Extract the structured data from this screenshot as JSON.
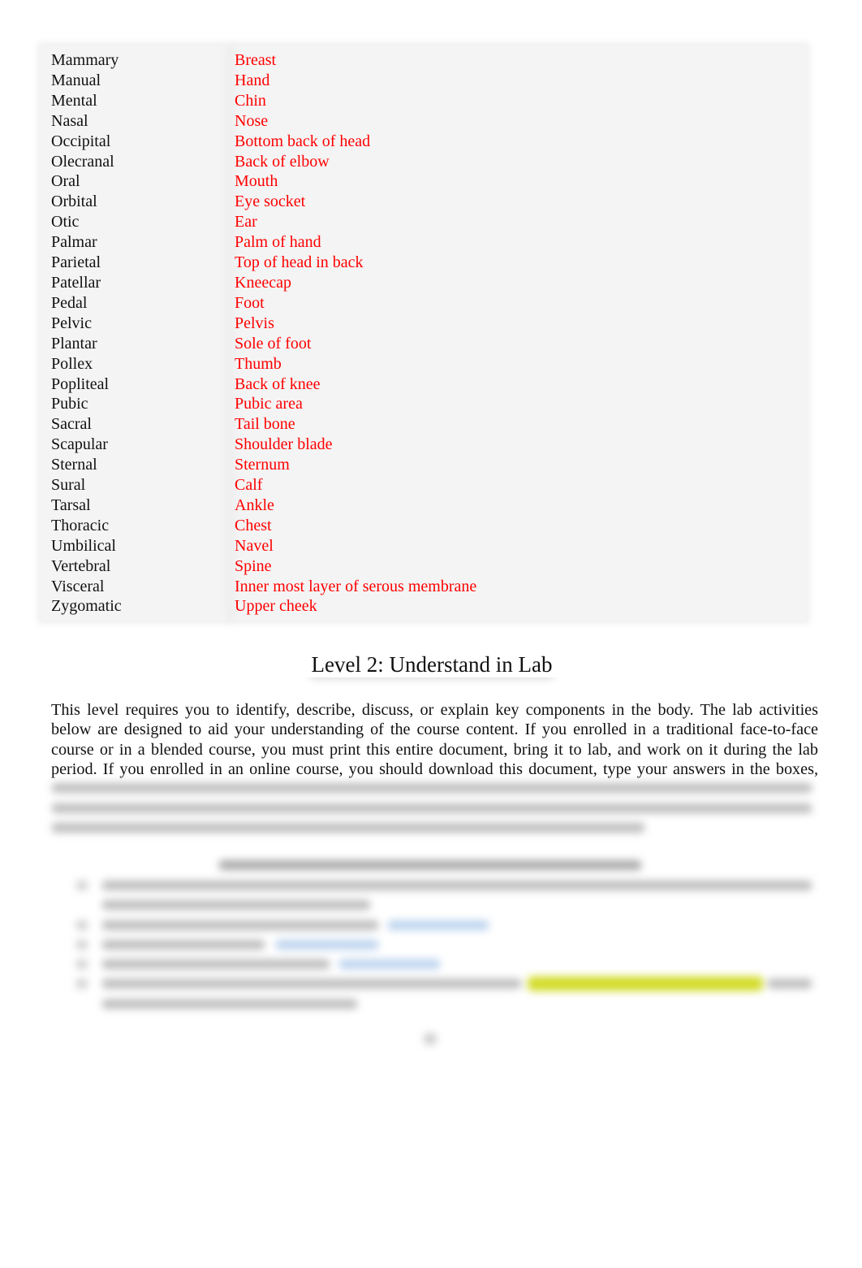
{
  "table": {
    "rows": [
      {
        "term": "Mammary",
        "meaning": "Breast"
      },
      {
        "term": "Manual",
        "meaning": "Hand"
      },
      {
        "term": "Mental",
        "meaning": "Chin"
      },
      {
        "term": "Nasal",
        "meaning": "Nose"
      },
      {
        "term": "Occipital",
        "meaning": "Bottom back of head"
      },
      {
        "term": "Olecranal",
        "meaning": "Back of elbow"
      },
      {
        "term": "Oral",
        "meaning": "Mouth"
      },
      {
        "term": "Orbital",
        "meaning": "Eye socket"
      },
      {
        "term": "Otic",
        "meaning": "Ear"
      },
      {
        "term": "Palmar",
        "meaning": "Palm of hand"
      },
      {
        "term": "Parietal",
        "meaning": "Top of head in back"
      },
      {
        "term": "Patellar",
        "meaning": "Kneecap"
      },
      {
        "term": "Pedal",
        "meaning": "Foot"
      },
      {
        "term": "Pelvic",
        "meaning": "Pelvis"
      },
      {
        "term": "Plantar",
        "meaning": "Sole of foot"
      },
      {
        "term": "Pollex",
        "meaning": "Thumb"
      },
      {
        "term": "Popliteal",
        "meaning": "Back of knee"
      },
      {
        "term": "Pubic",
        "meaning": "Pubic area"
      },
      {
        "term": "Sacral",
        "meaning": "Tail bone"
      },
      {
        "term": "Scapular",
        "meaning": "Shoulder blade"
      },
      {
        "term": "Sternal",
        "meaning": "Sternum"
      },
      {
        "term": "Sural",
        "meaning": "Calf"
      },
      {
        "term": "Tarsal",
        "meaning": "Ankle"
      },
      {
        "term": "Thoracic",
        "meaning": "Chest"
      },
      {
        "term": "Umbilical",
        "meaning": "Navel"
      },
      {
        "term": "Vertebral",
        "meaning": "Spine"
      },
      {
        "term": "Visceral",
        "meaning": "Inner most layer of serous membrane"
      },
      {
        "term": "Zygomatic",
        "meaning": "Upper cheek"
      }
    ]
  },
  "section": {
    "heading": "Level 2: Understand in Lab",
    "paragraph_lines": [
      "This level requires you to identify, describe, discuss, or explain key components in the body. The lab activities",
      "below are designed to aid your understanding of the course content. If you enrolled in a traditional face-to-face",
      "course or in a blended course, you must print this entire document, bring it to lab, and work on it during the lab",
      "period. If you enrolled in an online course, you should download this document, type your answers in the boxes,"
    ]
  },
  "colors": {
    "meaning_text": "#ff0000",
    "body_text": "#111111",
    "link_blur": "#bcd3ee",
    "highlight_blur": "#d3dc2a"
  }
}
